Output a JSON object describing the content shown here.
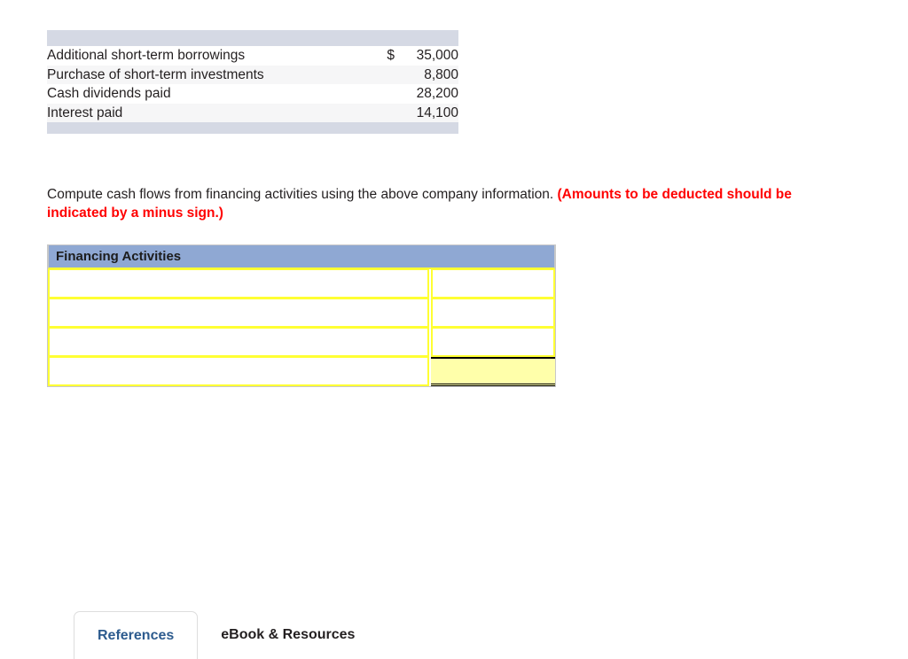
{
  "given_table": {
    "rows": [
      {
        "label": "Additional short-term borrowings",
        "currency": "$",
        "value": "35,000"
      },
      {
        "label": "Purchase of short-term investments",
        "currency": "",
        "value": "8,800"
      },
      {
        "label": "Cash dividends paid",
        "currency": "",
        "value": "28,200"
      },
      {
        "label": "Interest paid",
        "currency": "",
        "value": "14,100"
      }
    ]
  },
  "instruction": {
    "plain": "Compute cash flows from financing activities using the above company information. ",
    "emphasis": "(Amounts to be deducted should be indicated by a minus sign.)"
  },
  "answer_table": {
    "header": "Financing Activities",
    "rows": [
      {
        "description": "",
        "amount": "",
        "total": false
      },
      {
        "description": "",
        "amount": "",
        "total": false
      },
      {
        "description": "",
        "amount": "",
        "total": false
      },
      {
        "description": "",
        "amount": "",
        "total": true
      }
    ],
    "input_placeholder": ""
  },
  "tabs": [
    {
      "label": "References",
      "active": true
    },
    {
      "label": "eBook & Resources",
      "active": false
    }
  ],
  "colors": {
    "given_bar": "#d5d9e4",
    "given_row_alt": "#f6f6f7",
    "answer_header_blue": "#8fa8d3",
    "input_border_yellow": "#ffff33",
    "total_fill_yellow": "#ffffaa",
    "emphasis_red": "#ff0000",
    "active_tab_text": "#2d5b8e"
  }
}
